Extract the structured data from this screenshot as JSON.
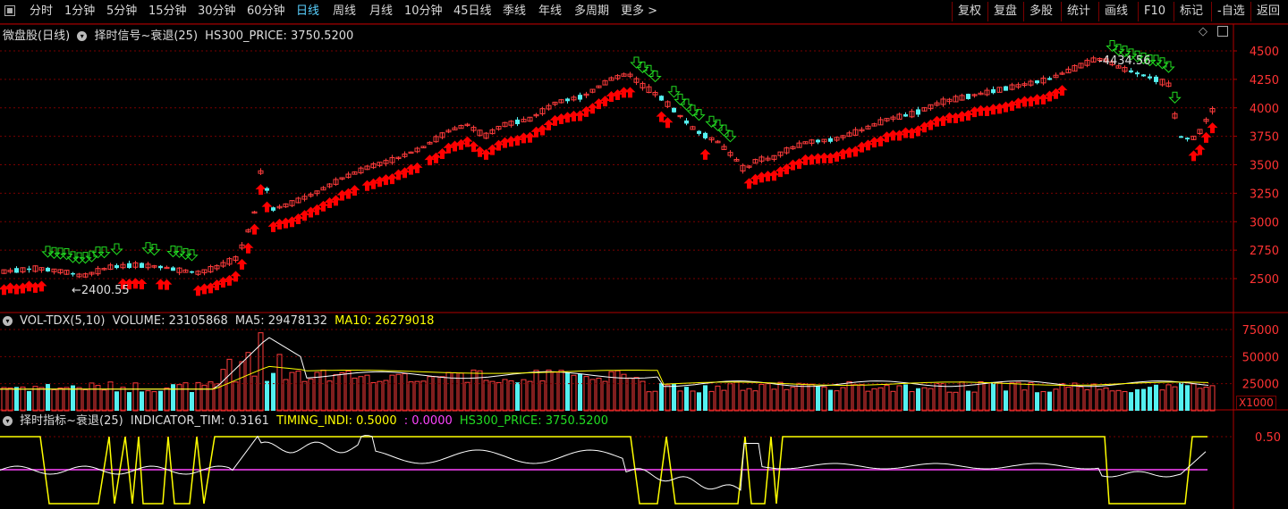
{
  "toolbar": {
    "periods": [
      "分时",
      "1分钟",
      "5分钟",
      "15分钟",
      "30分钟",
      "60分钟",
      "日线",
      "周线",
      "月线",
      "10分钟",
      "45日线",
      "季线",
      "年线",
      "多周期",
      "更多 >"
    ],
    "active_period": "日线",
    "right_buttons": [
      "复权",
      "复盘",
      "多股",
      "统计",
      "画线",
      "F10",
      "标记",
      "-自选",
      "返回"
    ]
  },
  "main_panel": {
    "title": "微盘股(日线)",
    "indicator": "择时信号~衰退(25)",
    "hs300": "HS300_PRICE: 3750.5200",
    "low_marker": "2400.55",
    "high_marker": "4434.56",
    "y_ticks": [
      "4500",
      "4250",
      "4000",
      "3750",
      "3500",
      "3250",
      "3000",
      "2750",
      "2500"
    ]
  },
  "vol_panel": {
    "title": "VOL-TDX(5,10)",
    "volume": "VOLUME: 23105868",
    "ma5": "MA5: 29478132",
    "ma10": "MA10: 26279018",
    "y_ticks": [
      "75000",
      "50000",
      "25000"
    ],
    "unit": "X1000"
  },
  "ind_panel": {
    "title": "择时指标~衰退(25)",
    "tim": "INDICATOR_TIM: 0.3161",
    "timing": "TIMING_INDI: 0.5000",
    "zero": ": 0.0000",
    "hs300": "HS300_PRICE: 3750.5200",
    "y_ticks": [
      "0.50"
    ]
  },
  "colors": {
    "up": "#ff3c3c",
    "down": "#54f0f0",
    "buy_arrow": "#ff0000",
    "sell_arrow": "#22dd22",
    "grid": "#7a0000",
    "ma10": "#ffff00",
    "timing": "#ffff00",
    "zero": "#ff44ff",
    "hs300": "#22dd22"
  },
  "icons": {
    "panel_toggle": "circle-down-icon",
    "diamond": "diamond-icon",
    "window": "window-icon"
  }
}
